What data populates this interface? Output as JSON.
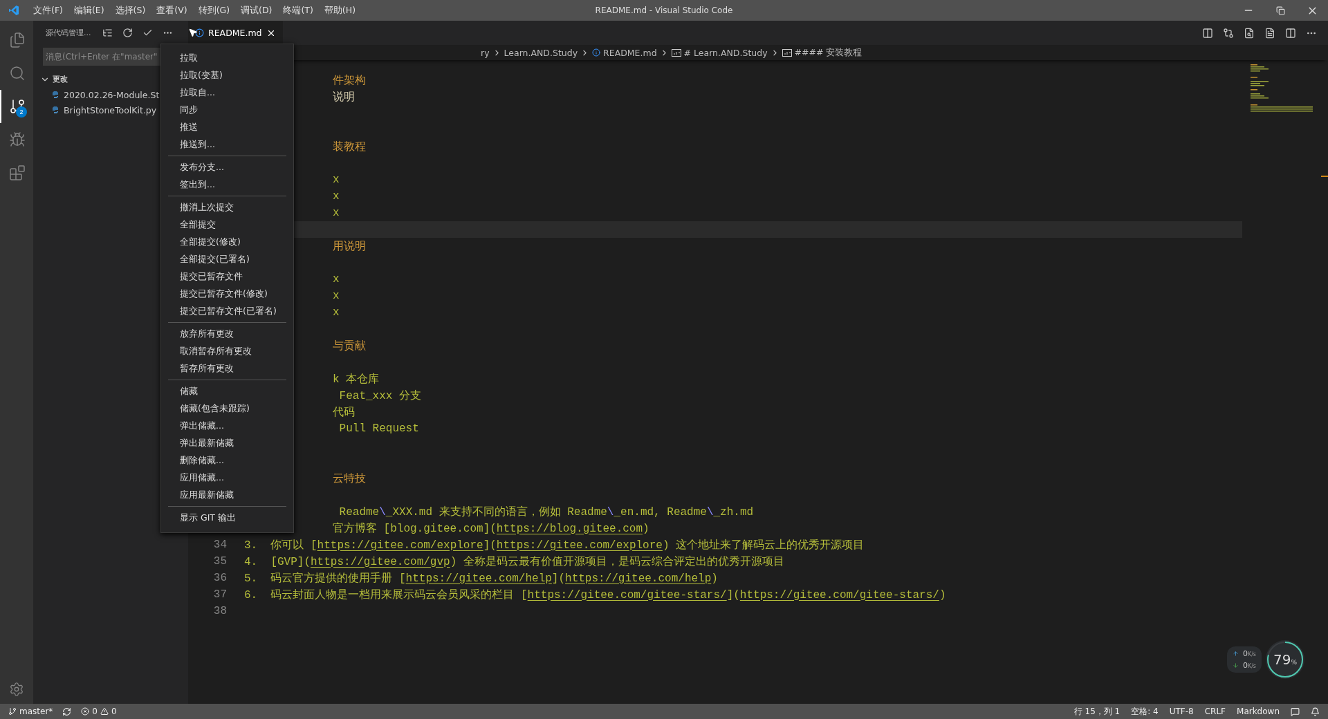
{
  "title_bar": {
    "menus": [
      "文件(F)",
      "编辑(E)",
      "选择(S)",
      "查看(V)",
      "转到(G)",
      "调试(D)",
      "终端(T)",
      "帮助(H)"
    ],
    "title": "README.md - Visual Studio Code"
  },
  "activity_bar": {
    "items": [
      {
        "kind": "files",
        "selected": false
      },
      {
        "kind": "search",
        "selected": false
      },
      {
        "kind": "scm",
        "selected": true,
        "badge": "2"
      },
      {
        "kind": "debug",
        "selected": false
      },
      {
        "kind": "extensions",
        "selected": false
      }
    ]
  },
  "sidebar": {
    "title": "源代码管理...",
    "message_placeholder": "消息(Ctrl+Enter 在\"master\"",
    "section": {
      "label": "更改",
      "expanded": true,
      "files": [
        "2020.02.26-Module.St",
        "BrightStoneToolKit.py"
      ]
    }
  },
  "tab": {
    "label": "README.md",
    "selected": true
  },
  "breadcrumbs": [
    {
      "kind": "text",
      "label": "ry"
    },
    {
      "kind": "text",
      "label": "Learn.AND.Study"
    },
    {
      "kind": "file",
      "label": "README.md"
    },
    {
      "kind": "symbol",
      "label": "# Learn.AND.Study"
    },
    {
      "kind": "symbol",
      "label": "#### 安装教程"
    }
  ],
  "context_menu": {
    "groups": [
      [
        "拉取",
        "拉取(变基)",
        "拉取自...",
        "同步",
        "推送",
        "推送到..."
      ],
      [
        "发布分支...",
        "签出到..."
      ],
      [
        "撤消上次提交",
        "全部提交",
        "全部提交(修改)",
        "全部提交(已署名)",
        "提交已暂存文件",
        "提交已暂存文件(修改)",
        "提交已暂存文件(已署名)"
      ],
      [
        "放弃所有更改",
        "取消暂存所有更改",
        "暂存所有更改"
      ],
      [
        "储藏",
        "储藏(包含未跟踪)",
        "弹出储藏...",
        "弹出最新储藏",
        "删除储藏...",
        "应用储藏...",
        "应用最新储藏"
      ],
      [
        "显示 GIT 输出"
      ]
    ]
  },
  "editor": {
    "lines": [
      {
        "current": false,
        "segments": [
          {
            "kind": "heading",
            "text": "件架构"
          }
        ]
      },
      {
        "current": false,
        "segments": [
          {
            "kind": "plain",
            "text": "说明"
          }
        ]
      },
      {
        "current": false
      },
      {
        "current": false
      },
      {
        "current": false,
        "segments": [
          {
            "kind": "heading",
            "text": "装教程"
          }
        ]
      },
      {
        "current": false
      },
      {
        "current": false,
        "segments": [
          {
            "kind": "list",
            "text": "x"
          }
        ]
      },
      {
        "current": false,
        "segments": [
          {
            "kind": "list",
            "text": "x"
          }
        ]
      },
      {
        "current": false,
        "segments": [
          {
            "kind": "list",
            "text": "x"
          }
        ]
      },
      {
        "current": true
      },
      {
        "current": false,
        "segments": [
          {
            "kind": "heading",
            "text": "用说明"
          }
        ]
      },
      {
        "current": false
      },
      {
        "current": false,
        "segments": [
          {
            "kind": "list",
            "text": "x"
          }
        ]
      },
      {
        "current": false,
        "segments": [
          {
            "kind": "list",
            "text": "x"
          }
        ]
      },
      {
        "current": false,
        "segments": [
          {
            "kind": "list",
            "text": "x"
          }
        ]
      },
      {
        "current": false
      },
      {
        "current": false,
        "segments": [
          {
            "kind": "heading",
            "text": "与贡献"
          }
        ]
      },
      {
        "current": false
      },
      {
        "current": false,
        "segments": [
          {
            "kind": "list",
            "text": "k 本仓库"
          }
        ]
      },
      {
        "current": false,
        "segments": [
          {
            "kind": "list",
            "text": " Feat_xxx 分支"
          }
        ]
      },
      {
        "current": false,
        "segments": [
          {
            "kind": "list",
            "text": "代码"
          }
        ]
      },
      {
        "current": false,
        "segments": [
          {
            "kind": "list",
            "text": " Pull Request"
          }
        ]
      },
      {
        "current": false
      },
      {
        "current": false
      },
      {
        "current": false,
        "segments": [
          {
            "kind": "heading",
            "text": "云特技"
          }
        ]
      },
      {
        "current": false
      },
      {
        "current": false,
        "segments": [
          {
            "kind": "list",
            "text": " Readme"
          },
          {
            "kind": "escape",
            "text": "\\"
          },
          {
            "kind": "list",
            "text": "_XXX.md 来支持不同的语言，例如 Readme"
          },
          {
            "kind": "escape",
            "text": "\\"
          },
          {
            "kind": "list",
            "text": "_en.md, Readme"
          },
          {
            "kind": "escape",
            "text": "\\"
          },
          {
            "kind": "list",
            "text": "_zh.md"
          }
        ]
      },
      {
        "current": false,
        "segments": [
          {
            "kind": "list",
            "text": "官方博客 [blog.gitee.com]("
          },
          {
            "kind": "link",
            "text": "https://blog.gitee.com"
          },
          {
            "kind": "list",
            "text": ")"
          }
        ]
      },
      {
        "current": false,
        "number": "34",
        "segments": [
          {
            "kind": "list",
            "text": "3.  你可以 ["
          },
          {
            "kind": "link",
            "text": "https://gitee.com/explore"
          },
          {
            "kind": "list",
            "text": "]("
          },
          {
            "kind": "link",
            "text": "https://gitee.com/explore"
          },
          {
            "kind": "list",
            "text": ") 这个地址来了解码云上的优秀开源项目"
          }
        ]
      },
      {
        "current": false,
        "number": "35",
        "segments": [
          {
            "kind": "list",
            "text": "4.  [GVP]("
          },
          {
            "kind": "link",
            "text": "https://gitee.com/gvp"
          },
          {
            "kind": "list",
            "text": ") 全称是码云最有价值开源项目，是码云综合评定出的优秀开源项目"
          }
        ]
      },
      {
        "current": false,
        "number": "36",
        "segments": [
          {
            "kind": "list",
            "text": "5.  码云官方提供的使用手册 ["
          },
          {
            "kind": "link",
            "text": "https://gitee.com/help"
          },
          {
            "kind": "list",
            "text": "]("
          },
          {
            "kind": "link",
            "text": "https://gitee.com/help"
          },
          {
            "kind": "list",
            "text": ")"
          }
        ]
      },
      {
        "current": false,
        "number": "37",
        "segments": [
          {
            "kind": "list",
            "text": "6.  码云封面人物是一档用来展示码云会员风采的栏目 ["
          },
          {
            "kind": "link",
            "text": "https://gitee.com/gitee-stars/"
          },
          {
            "kind": "list",
            "text": "]("
          },
          {
            "kind": "link",
            "text": "https://gitee.com/gitee-stars/"
          },
          {
            "kind": "list",
            "text": ")"
          }
        ]
      },
      {
        "current": false,
        "number": "38"
      }
    ]
  },
  "network_monitor": {
    "up": {
      "value": "0",
      "unit": "K/s"
    },
    "down": {
      "value": "0",
      "unit": "K/s"
    },
    "gauge": {
      "value": "79",
      "unit": "%"
    }
  },
  "status_bar": {
    "branch": "master*",
    "errors": "0",
    "warnings": "0",
    "right": [
      "行 15，列 1",
      "空格: 4",
      "UTF-8",
      "CRLF",
      "Markdown"
    ]
  }
}
